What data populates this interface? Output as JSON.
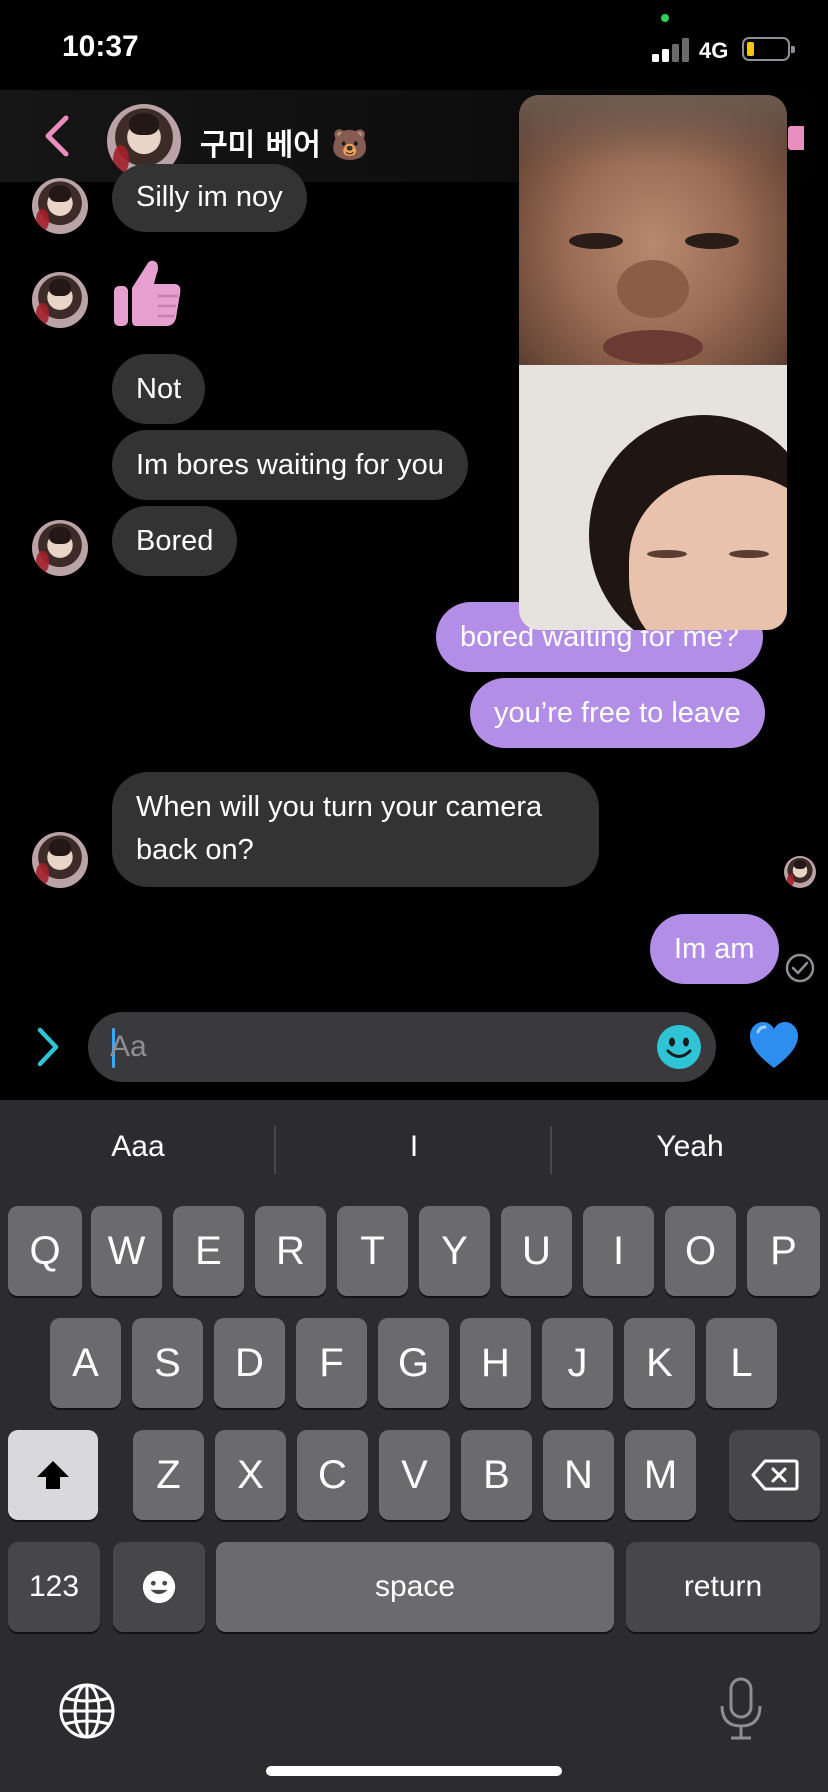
{
  "status_bar": {
    "time": "10:37",
    "network": "4G"
  },
  "header": {
    "contact_name": "구미 베어 🐻"
  },
  "messages": [
    {
      "from": "contact",
      "text": "Silly im noy"
    },
    {
      "from": "contact",
      "type": "sticker",
      "icon": "thumbs-up-icon"
    },
    {
      "from": "contact",
      "text": "Not"
    },
    {
      "from": "contact",
      "text": "Im bores waiting for you"
    },
    {
      "from": "contact",
      "text": "Bored"
    },
    {
      "from": "me",
      "text": "bored waiting for me?"
    },
    {
      "from": "me",
      "text": "you’re free to leave"
    },
    {
      "from": "contact",
      "text": "When will you turn your camera back on?"
    },
    {
      "from": "me",
      "text": "Im am"
    }
  ],
  "composer": {
    "placeholder": "Aa"
  },
  "keyboard": {
    "suggestions": [
      "Aaa",
      "I",
      "Yeah"
    ],
    "row1": [
      "Q",
      "W",
      "E",
      "R",
      "T",
      "Y",
      "U",
      "I",
      "O",
      "P"
    ],
    "row2": [
      "A",
      "S",
      "D",
      "F",
      "G",
      "H",
      "J",
      "K",
      "L"
    ],
    "row3": [
      "Z",
      "X",
      "C",
      "V",
      "B",
      "N",
      "M"
    ],
    "numbers_label": "123",
    "space_label": "space",
    "return_label": "return"
  },
  "colors": {
    "accent_pink": "#e88fbf",
    "outgoing_bubble": "#b38ee6",
    "incoming_bubble": "#333334",
    "composer_icons": "#2ec4d6"
  }
}
